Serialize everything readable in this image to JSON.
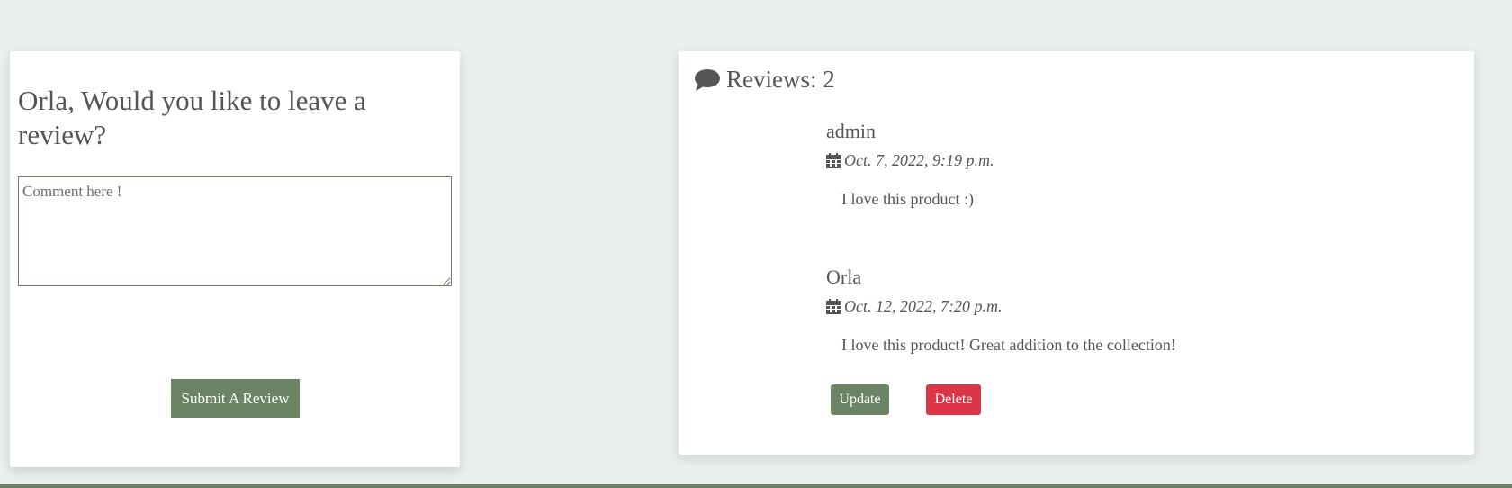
{
  "review_form": {
    "heading": "Orla, Would you like to leave a review?",
    "comment_value": "",
    "comment_placeholder": "Comment here !",
    "submit_label": "Submit A Review"
  },
  "reviews": {
    "title": "Reviews: 2",
    "icon": "comment-icon",
    "items": [
      {
        "author": "admin",
        "date": "Oct. 7, 2022, 9:19 p.m.",
        "body": "I love this product :)"
      },
      {
        "author": "Orla",
        "date": "Oct. 12, 2022, 7:20 p.m.",
        "body": "I love this product! Great addition to the collection!"
      }
    ],
    "actions": {
      "update_label": "Update",
      "delete_label": "Delete"
    }
  },
  "colors": {
    "page_bg": "#eaf0f0",
    "accent": "#6a8464",
    "danger": "#dc3545",
    "text": "#555555"
  }
}
